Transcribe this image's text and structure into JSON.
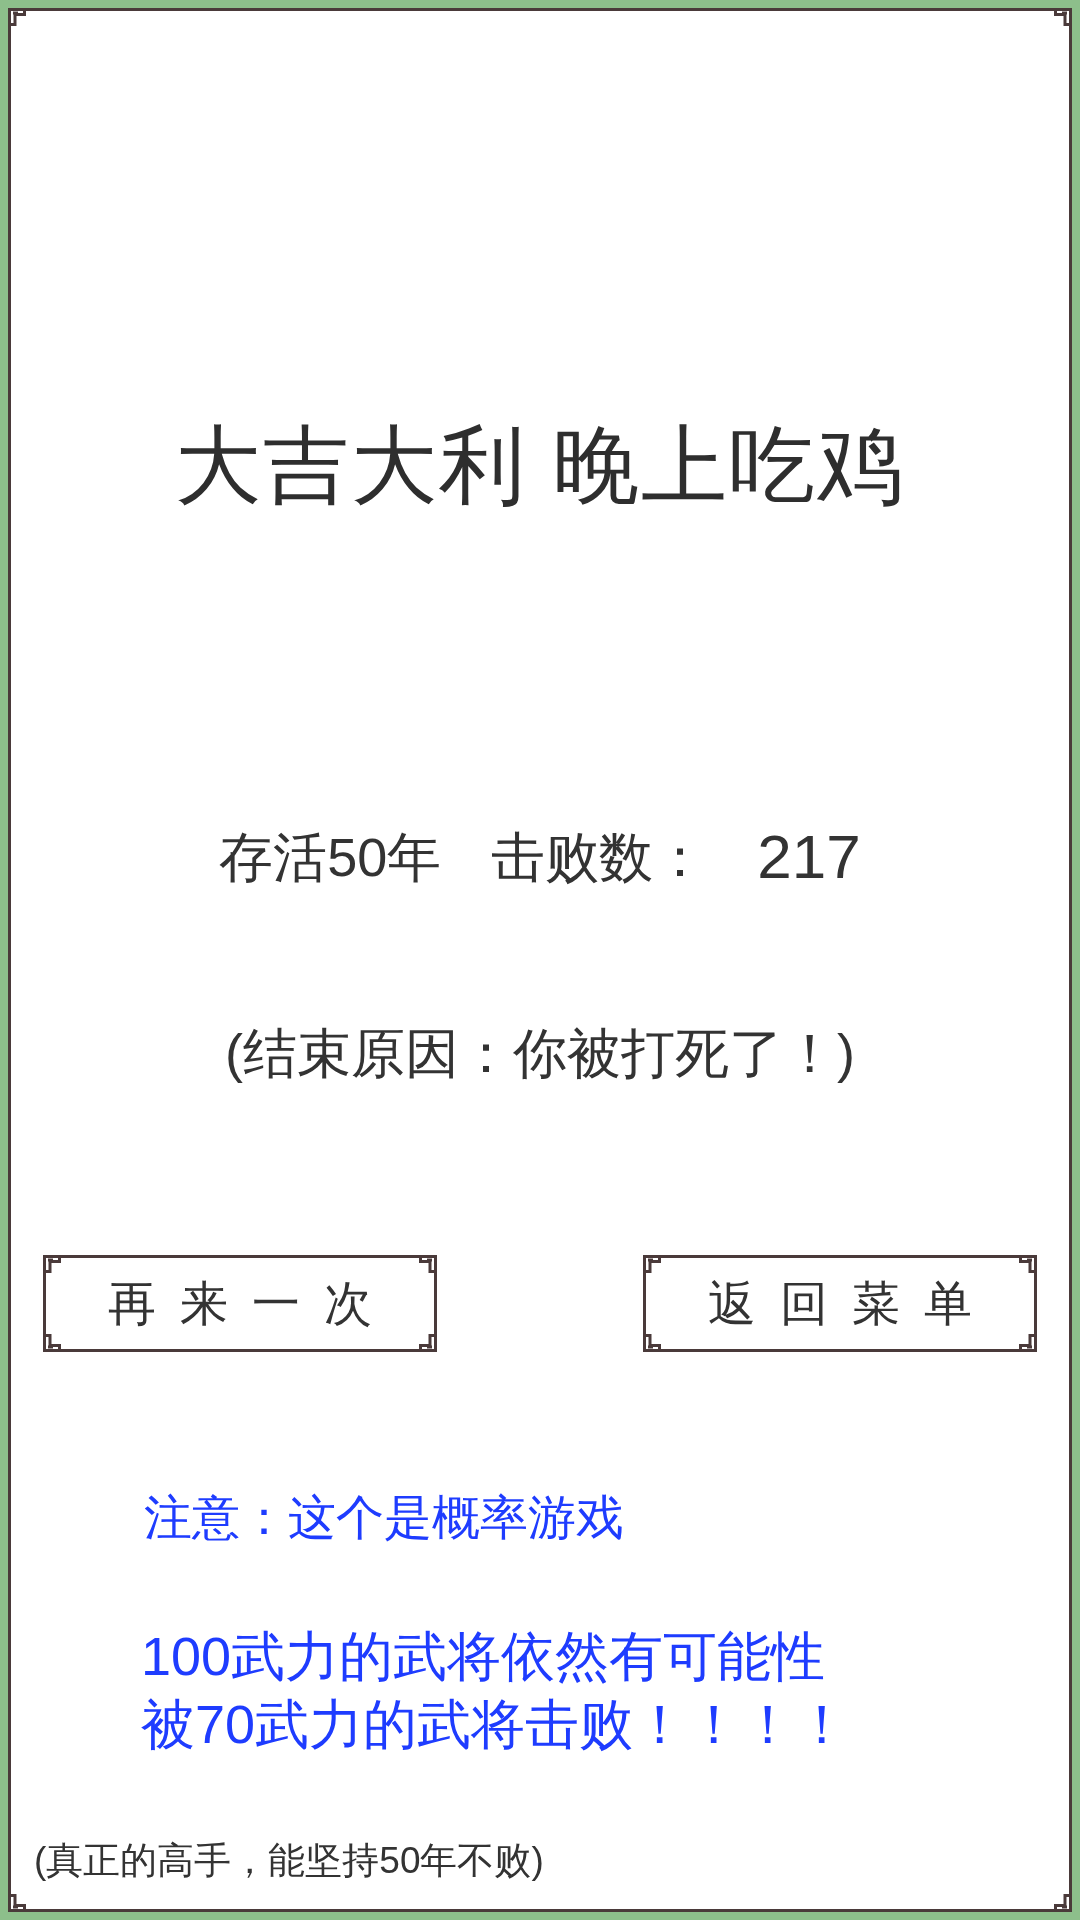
{
  "title": "大吉大利 晚上吃鸡",
  "stats": {
    "survived": "存活50年",
    "defeats_label": "击败数：",
    "defeats_value": "217"
  },
  "end_reason": "(结束原因：你被打死了！)",
  "buttons": [
    {
      "label": "再来一次"
    },
    {
      "label": "返回菜单"
    }
  ],
  "notice": "注意：这个是概率游戏",
  "warning": [
    "100武力的武将依然有可能性",
    "被70武力的武将击败！！！！"
  ],
  "footer": "(真正的高手，能坚持50年不败)"
}
